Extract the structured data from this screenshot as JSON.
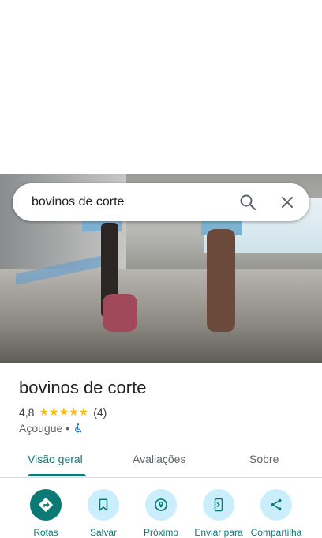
{
  "search": {
    "query": "bovinos de corte"
  },
  "place": {
    "name": "bovinos de corte",
    "rating": "4,8",
    "stars": "★★★★★",
    "review_count": "(4)",
    "category": "Açougue",
    "separator": "•"
  },
  "tabs": [
    {
      "label": "Visão geral"
    },
    {
      "label": "Avaliações"
    },
    {
      "label": "Sobre"
    }
  ],
  "actions": [
    {
      "label": "Rotas"
    },
    {
      "label": "Salvar"
    },
    {
      "label": "Próximo"
    },
    {
      "label": "Enviar para"
    },
    {
      "label": "Compartilha"
    }
  ],
  "colors": {
    "accent": "#0b7a75",
    "star": "#fbbc04",
    "action_bg": "#cbeefc"
  }
}
